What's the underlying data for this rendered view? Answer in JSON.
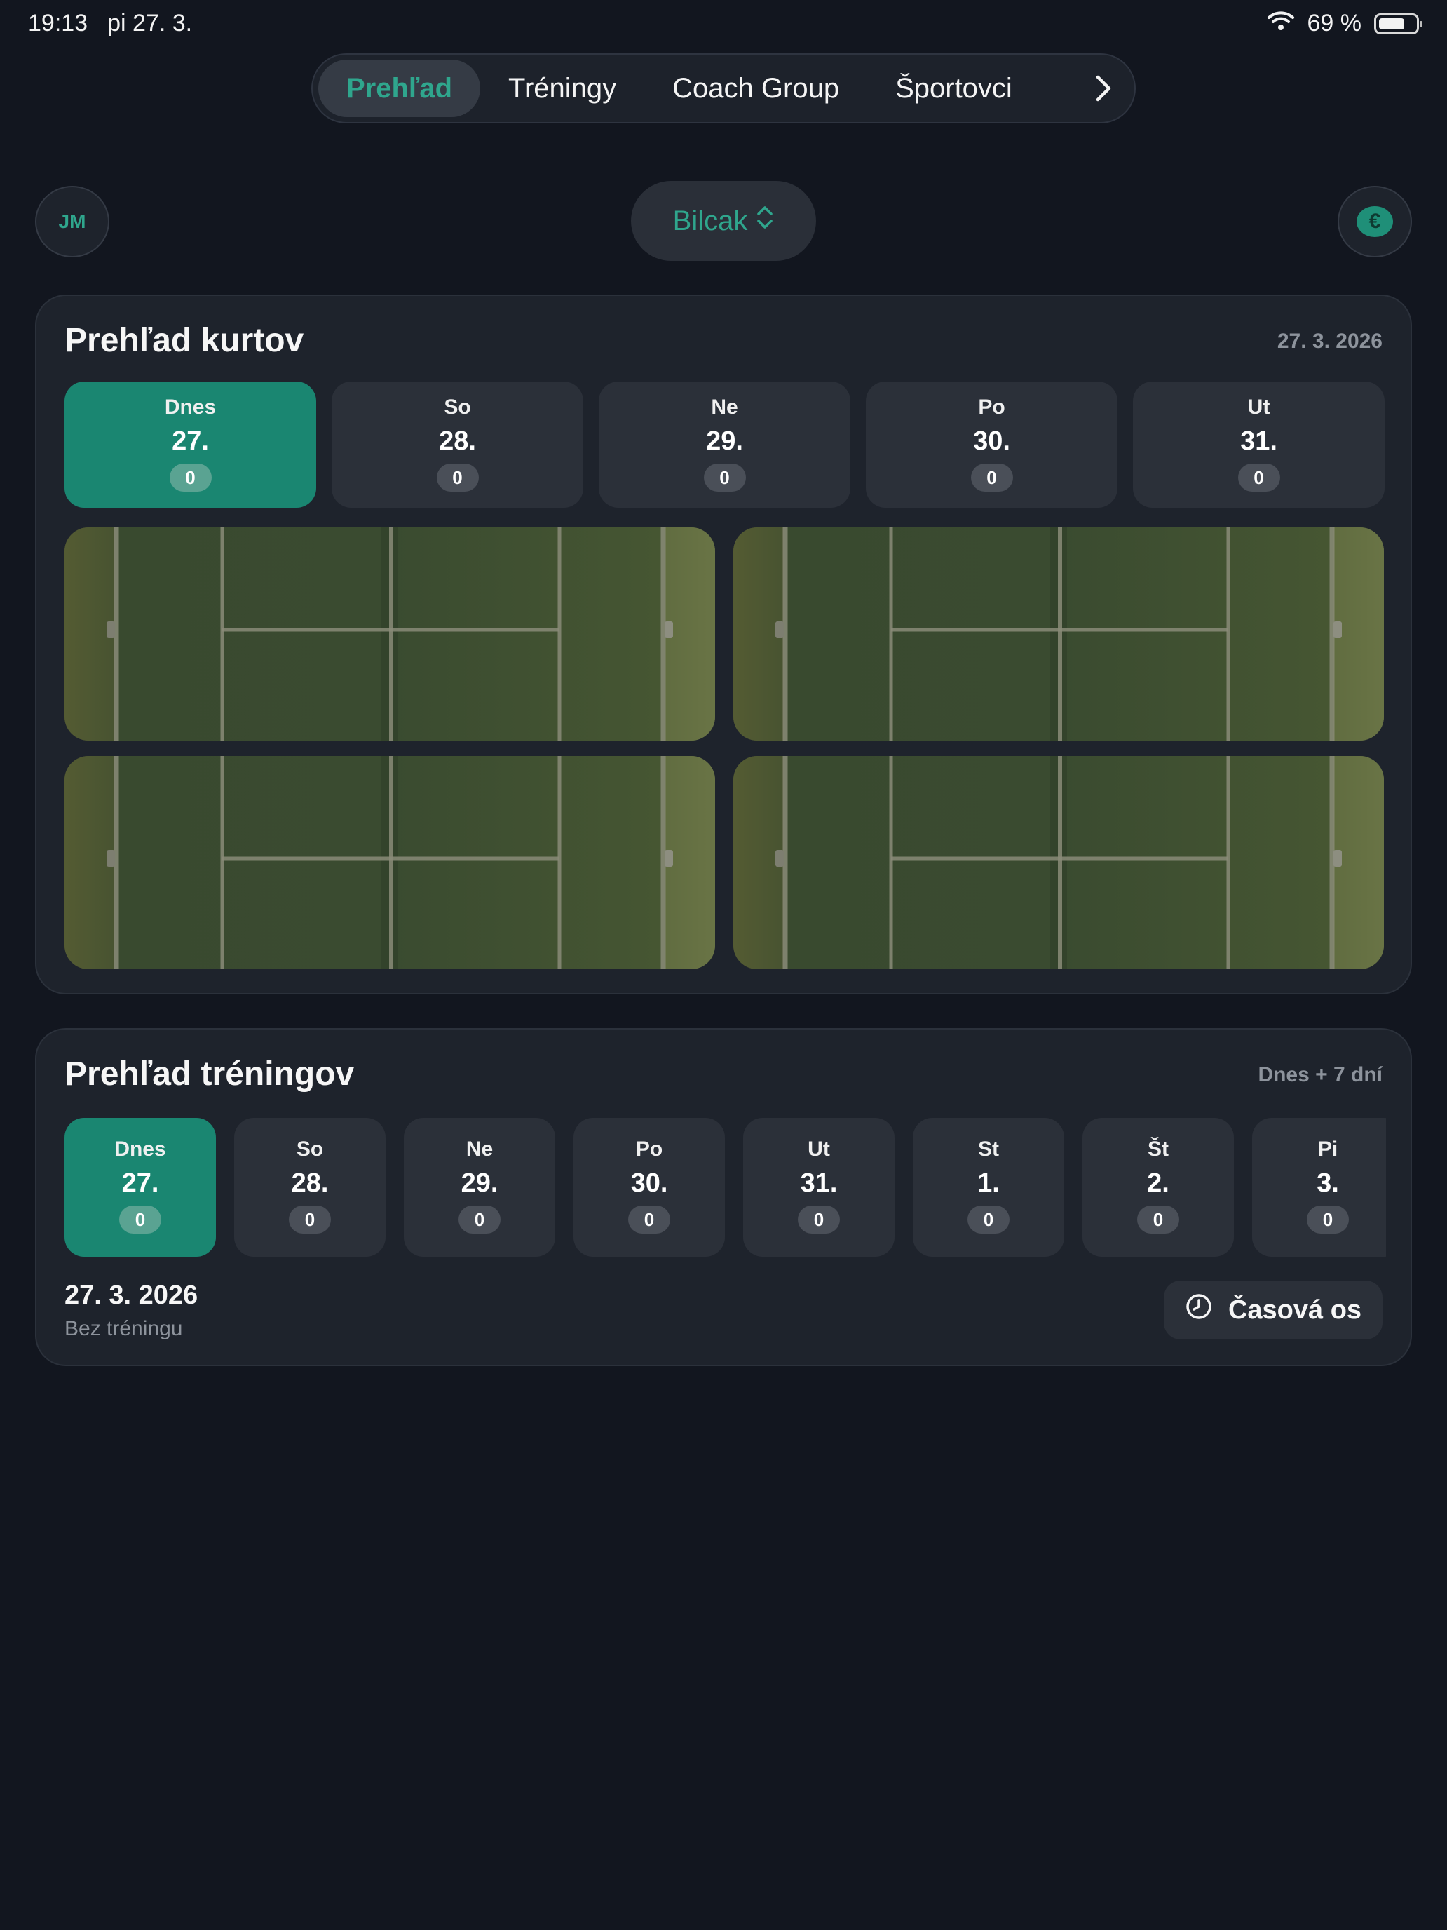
{
  "status_bar": {
    "time": "19:13",
    "date": "pi 27. 3.",
    "battery_text": "69 %",
    "battery_level": 0.69
  },
  "nav": {
    "tabs": [
      {
        "label": "Prehľad",
        "active": true
      },
      {
        "label": "Tréningy",
        "active": false
      },
      {
        "label": "Coach Group",
        "active": false
      },
      {
        "label": "Športovci",
        "active": false
      }
    ],
    "more_icon": "chevron-right-icon"
  },
  "header": {
    "avatar_initials": "JM",
    "site_name": "Bilcak",
    "site_icon": "chevron-up-down-icon",
    "currency_symbol": "€"
  },
  "courts_overview": {
    "title": "Prehľad kurtov",
    "date": "27. 3. 2026",
    "days": [
      {
        "label": "Dnes",
        "day": "27.",
        "count": "0",
        "active": true
      },
      {
        "label": "So",
        "day": "28.",
        "count": "0",
        "active": false
      },
      {
        "label": "Ne",
        "day": "29.",
        "count": "0",
        "active": false
      },
      {
        "label": "Po",
        "day": "30.",
        "count": "0",
        "active": false
      },
      {
        "label": "Ut",
        "day": "31.",
        "count": "0",
        "active": false
      }
    ],
    "courts_count": 4
  },
  "trainings_overview": {
    "title": "Prehľad tréningov",
    "range": "Dnes + 7 dní",
    "days": [
      {
        "label": "Dnes",
        "day": "27.",
        "count": "0",
        "active": true
      },
      {
        "label": "So",
        "day": "28.",
        "count": "0",
        "active": false
      },
      {
        "label": "Ne",
        "day": "29.",
        "count": "0",
        "active": false
      },
      {
        "label": "Po",
        "day": "30.",
        "count": "0",
        "active": false
      },
      {
        "label": "Ut",
        "day": "31.",
        "count": "0",
        "active": false
      },
      {
        "label": "St",
        "day": "1.",
        "count": "0",
        "active": false
      },
      {
        "label": "Št",
        "day": "2.",
        "count": "0",
        "active": false
      },
      {
        "label": "Pi",
        "day": "3.",
        "count": "0",
        "active": false
      }
    ],
    "selected_date": "27. 3. 2026",
    "selected_status": "Bez tréningu",
    "timeline_button": "Časová os",
    "timeline_icon": "clock-icon"
  },
  "colors": {
    "accent": "#2fa68d",
    "active_tile": "#1a8671",
    "background": "#12161f"
  }
}
